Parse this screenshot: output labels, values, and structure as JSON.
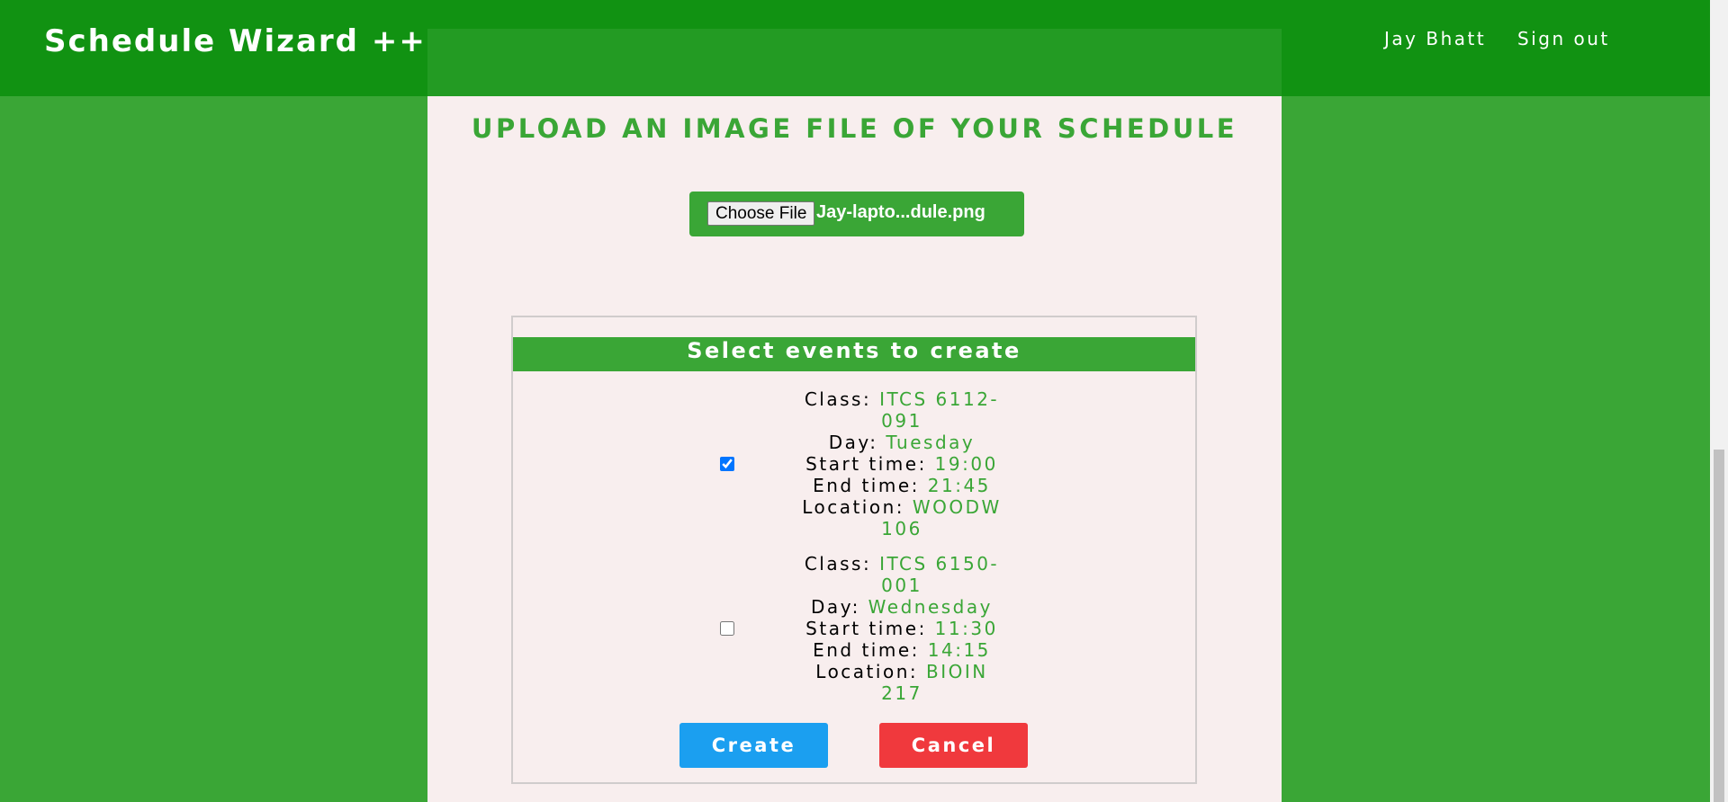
{
  "navbar": {
    "brand": "Schedule Wizard ++",
    "user_name": "Jay Bhatt",
    "sign_out": "Sign out"
  },
  "upload": {
    "heading": "UPLOAD AN IMAGE FILE OF YOUR SCHEDULE",
    "choose_file_label": "Choose File",
    "file_name": "Jay-lapto...dule.png"
  },
  "events": {
    "header": "Select events to create",
    "labels": {
      "class": "Class:",
      "day": "Day:",
      "start": "Start time:",
      "end": "End time:",
      "location": "Location:"
    },
    "items": [
      {
        "checked": true,
        "class_line1": "ITCS 6112-",
        "class_line2": "091",
        "day": "Tuesday",
        "start": "19:00",
        "end": "21:45",
        "location_line1": "WOODW",
        "location_line2": "106"
      },
      {
        "checked": false,
        "class_line1": "ITCS 6150-",
        "class_line2": "001",
        "day": "Wednesday",
        "start": "11:30",
        "end": "14:15",
        "location_line1": "BIOIN",
        "location_line2": "217"
      }
    ]
  },
  "actions": {
    "create": "Create",
    "cancel": "Cancel"
  },
  "colors": {
    "navbar": "#119212",
    "background": "#3aa636",
    "panel": "#f8eeee",
    "create": "#1b9ff0",
    "cancel": "#f0393d"
  }
}
